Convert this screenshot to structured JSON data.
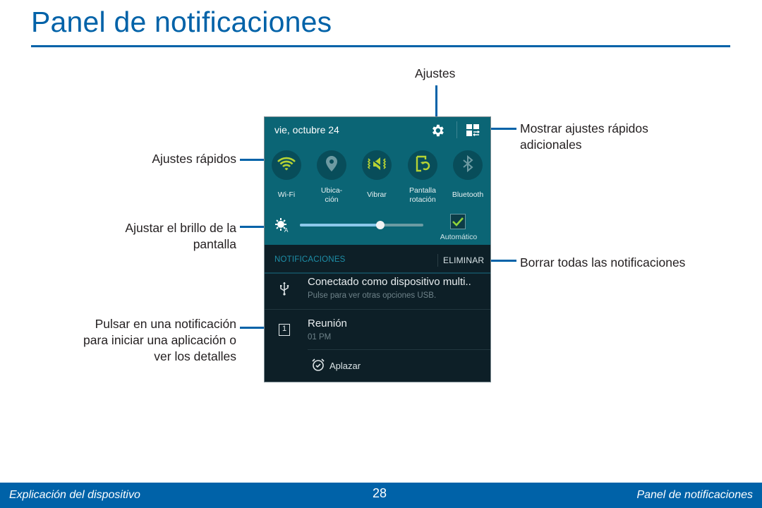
{
  "page": {
    "title": "Panel de notificaciones",
    "accent_color": "#0062a8"
  },
  "callouts": {
    "settings": "Ajustes",
    "quick_settings": "Ajustes rápidos",
    "brightness_line1": "Ajustar el brillo de la",
    "brightness_line2": "pantalla",
    "tap_notification_line1": "Pulsar en una notificación",
    "tap_notification_line2": "para iniciar una aplicación o",
    "tap_notification_line3": "ver los detalles",
    "more_quick_settings_line1": "Mostrar ajustes rápidos",
    "more_quick_settings_line2": "adicionales",
    "clear_all": "Borrar todas las notificaciones"
  },
  "panel": {
    "date": "vie, octubre 24",
    "header_icons": [
      "settings-gear-icon",
      "quick-settings-grid-icon"
    ],
    "quick_settings": [
      {
        "label_line1": "Wi-Fi",
        "label_line2": "",
        "icon": "wifi-icon",
        "active": true
      },
      {
        "label_line1": "Ubica-",
        "label_line2": "ción",
        "icon": "location-icon",
        "active": false
      },
      {
        "label_line1": "Vibrar",
        "label_line2": "",
        "icon": "vibrate-icon",
        "active": true
      },
      {
        "label_line1": "Pantalla",
        "label_line2": "rotación",
        "icon": "screen-rotation-icon",
        "active": true
      },
      {
        "label_line1": "Bluetooth",
        "label_line2": "",
        "icon": "bluetooth-icon",
        "active": false
      }
    ],
    "brightness": {
      "level_percent": 65,
      "auto_label": "Automático",
      "auto_checked": true
    },
    "notifications_header": "NOTIFICACIONES",
    "clear_label": "ELIMINAR",
    "notifications": [
      {
        "icon": "usb-icon",
        "title": "Conectado como dispositivo multi..",
        "subtitle": "Pulse para ver otras opciones USB."
      },
      {
        "icon": "calendar-icon",
        "calendar_day": "1",
        "title": "Reunión",
        "subtitle": "01 PM",
        "action_label": "Aplazar",
        "action_icon": "alarm-clock-icon"
      }
    ],
    "colors": {
      "panel_top": "#0b6575",
      "panel_bottom": "#0d1f27",
      "active_icon": "#b5d334",
      "inactive_icon": "#6d9aa2"
    }
  },
  "footer": {
    "left": "Explicación del dispositivo",
    "page_number": "28",
    "right": "Panel de notificaciones"
  }
}
